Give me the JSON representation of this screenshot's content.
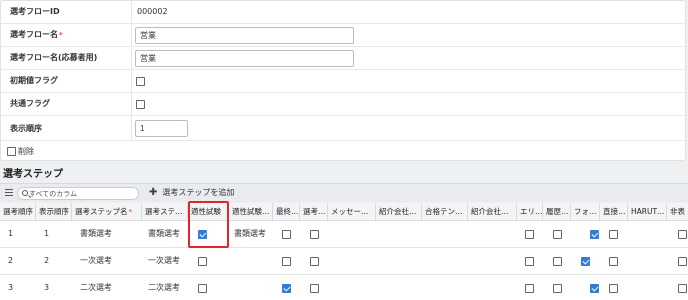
{
  "form": {
    "flow_id": {
      "label": "選考フローID",
      "value": "000002"
    },
    "flow_name": {
      "label": "選考フロー名",
      "required": "*",
      "value": "営業"
    },
    "flow_name_applicant": {
      "label": "選考フロー名(応募者用)",
      "value": "営業"
    },
    "initial_flag": {
      "label": "初期値フラグ",
      "checked": false
    },
    "shared_flag": {
      "label": "共通フラグ",
      "checked": false
    },
    "display_order": {
      "label": "表示順序",
      "value": "1"
    },
    "delete": {
      "label": "削除",
      "checked": false
    }
  },
  "steps_section": {
    "title": "選考ステップ",
    "search_placeholder": "すべてのカラム",
    "add_button_icon": "plus-icon",
    "add_button": "選考ステップを追加"
  },
  "grid": {
    "columns": [
      "選考順序",
      "表示順序",
      "選考ステップ名",
      "*",
      "選考ステ…",
      "適性試験",
      "適性試験…",
      "最終…",
      "選考…",
      "メッセー…",
      "紹介会社…",
      "合格テン…",
      "紹介会社…",
      "エリ…",
      "履歴…",
      "フォ…",
      "直接…",
      "HARUT…",
      "非表"
    ],
    "rows": [
      {
        "order": "1",
        "display": "1",
        "name": "書類選考",
        "type": "書類選考",
        "aptitude": true,
        "aptitude_name": "書類選考",
        "final": false,
        "sel": false,
        "c_eri": false,
        "c_rireki": false,
        "c_fo": true,
        "c_choku": false,
        "c_hi": false
      },
      {
        "order": "2",
        "display": "2",
        "name": "一次選考",
        "type": "一次選考",
        "aptitude": false,
        "aptitude_name": "",
        "final": false,
        "sel": false,
        "c_eri": false,
        "c_rireki": false,
        "c_fo": true,
        "c_choku": false,
        "c_hi": false
      },
      {
        "order": "3",
        "display": "3",
        "name": "二次選考",
        "type": "二次選考",
        "aptitude": false,
        "aptitude_name": "",
        "final": true,
        "sel": false,
        "c_eri": false,
        "c_rireki": false,
        "c_fo": true,
        "c_choku": false,
        "c_hi": false
      }
    ]
  },
  "colors": {
    "accent": "#2f7dd6",
    "highlight": "#e0262b",
    "required": "#e53935"
  }
}
